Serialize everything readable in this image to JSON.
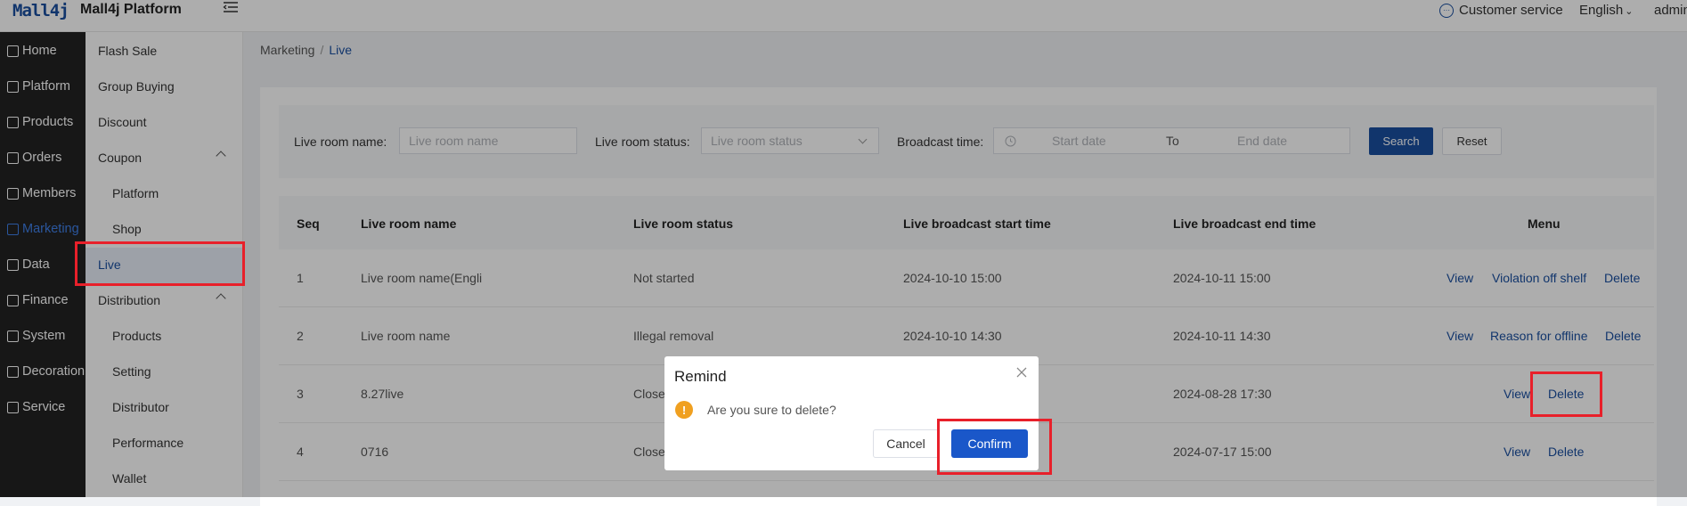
{
  "header": {
    "logo": "Mall4j",
    "title": "Mall4j Platform",
    "customer_service": "Customer service",
    "language": "English",
    "user": "admin"
  },
  "nav_main": [
    {
      "label": "Home",
      "icon": "home-icon"
    },
    {
      "label": "Platform",
      "icon": "platform-icon"
    },
    {
      "label": "Products",
      "icon": "products-icon"
    },
    {
      "label": "Orders",
      "icon": "orders-icon"
    },
    {
      "label": "Members",
      "icon": "members-icon"
    },
    {
      "label": "Marketing",
      "icon": "marketing-icon",
      "active": true
    },
    {
      "label": "Data",
      "icon": "data-icon"
    },
    {
      "label": "Finance",
      "icon": "finance-icon"
    },
    {
      "label": "System",
      "icon": "system-icon"
    },
    {
      "label": "Decoration",
      "icon": "decoration-icon"
    },
    {
      "label": "Service",
      "icon": "service-icon"
    }
  ],
  "nav_sub": [
    {
      "label": "Flash Sale"
    },
    {
      "label": "Group Buying"
    },
    {
      "label": "Discount"
    },
    {
      "label": "Coupon",
      "expanded": true
    },
    {
      "label": "Platform"
    },
    {
      "label": "Shop"
    },
    {
      "label": "Live",
      "active": true
    },
    {
      "label": "Distribution",
      "expanded": true
    },
    {
      "label": "Products"
    },
    {
      "label": "Setting"
    },
    {
      "label": "Distributor"
    },
    {
      "label": "Performance"
    },
    {
      "label": "Wallet"
    }
  ],
  "breadcrumb": {
    "parent": "Marketing",
    "separator": "/",
    "current": "Live"
  },
  "filters": {
    "room_name_label": "Live room name:",
    "room_name_placeholder": "Live room name",
    "room_status_label": "Live room status:",
    "room_status_placeholder": "Live room status",
    "broadcast_label": "Broadcast time:",
    "start_placeholder": "Start date",
    "to": "To",
    "end_placeholder": "End date",
    "search": "Search",
    "reset": "Reset"
  },
  "table": {
    "columns": [
      "Seq",
      "Live room name",
      "Live room status",
      "Live broadcast start time",
      "Live broadcast end time",
      "Menu"
    ],
    "rows": [
      {
        "seq": "1",
        "name": "Live room name(Engli",
        "status": "Not started",
        "start": "2024-10-10 15:00",
        "end": "2024-10-11 15:00",
        "actions": [
          "View",
          "Violation off shelf",
          "Delete"
        ]
      },
      {
        "seq": "2",
        "name": "Live room name",
        "status": "Illegal removal",
        "start": "2024-10-10 14:30",
        "end": "2024-10-11 14:30",
        "actions": [
          "View",
          "Reason for offline",
          "Delete"
        ]
      },
      {
        "seq": "3",
        "name": "8.27live",
        "status": "Close",
        "start": "",
        "end": "2024-08-28 17:30",
        "actions": [
          "View",
          "Delete"
        ]
      },
      {
        "seq": "4",
        "name": "0716",
        "status": "Close",
        "start": "",
        "end": "2024-07-17 15:00",
        "actions": [
          "View",
          "Delete"
        ]
      }
    ]
  },
  "dialog": {
    "title": "Remind",
    "message": "Are you sure to delete?",
    "cancel": "Cancel",
    "confirm": "Confirm",
    "icon": "warning-icon"
  },
  "colors": {
    "brand": "#1a4fa0",
    "confirm": "#1a57c9",
    "warning": "#f0a020",
    "highlight": "#e8202a",
    "nav_bg": "#232323"
  }
}
